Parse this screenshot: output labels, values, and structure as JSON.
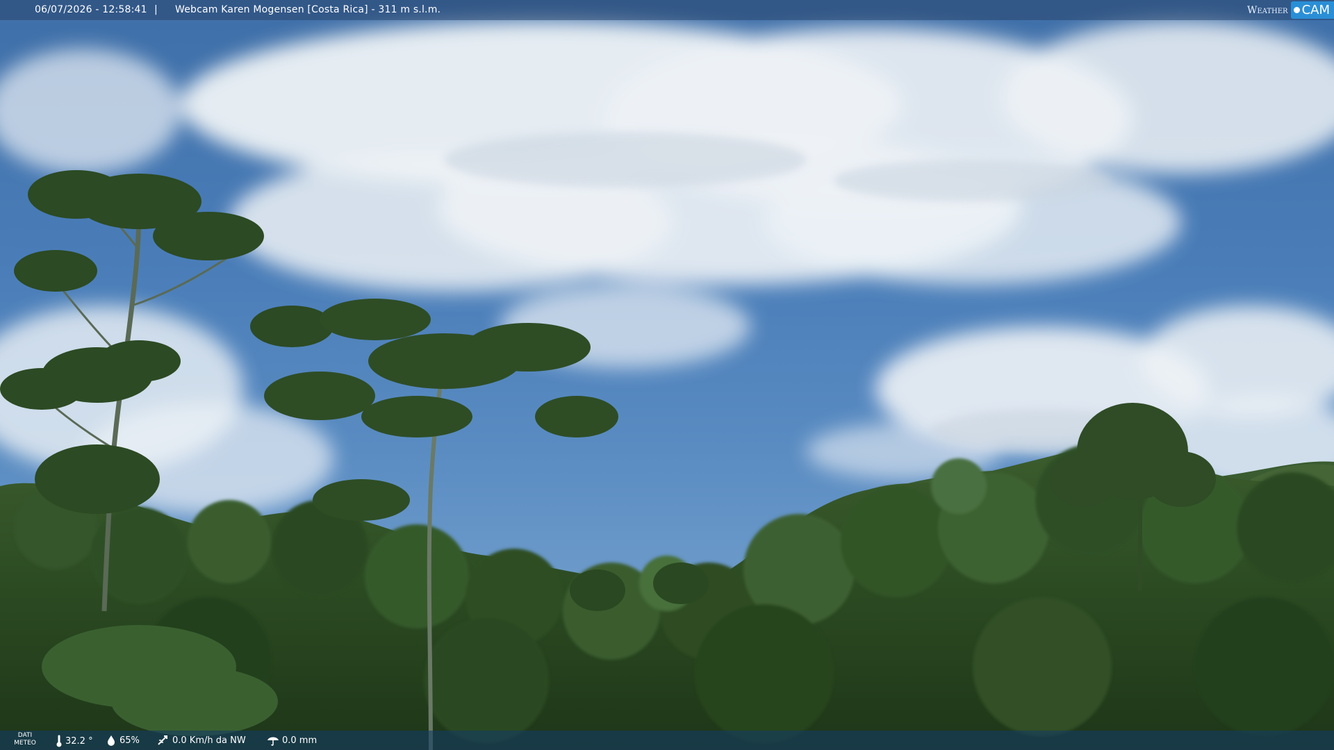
{
  "header": {
    "datetime": "06/07/2026 - 12:58:41",
    "separator": "|",
    "title": "Webcam Karen Mogensen [Costa Rica] - 311 m s.l.m."
  },
  "brand": {
    "weather": "Weather",
    "cam": "CAM"
  },
  "footer": {
    "dati_line1": "DATI",
    "dati_line2": "METEO",
    "temperature": "32.2 °",
    "humidity": "65%",
    "wind": "0.0 Km/h da NW",
    "rain": "0.0 mm"
  },
  "icons": {
    "temperature": "thermometer-icon",
    "humidity": "droplet-icon",
    "wind": "wind-icon",
    "rain": "umbrella-icon"
  },
  "colors": {
    "sky": "#4a7db8",
    "cloud": "#eef2f6",
    "forest": "#2d4a22",
    "brand_accent": "#2a8fd6"
  }
}
